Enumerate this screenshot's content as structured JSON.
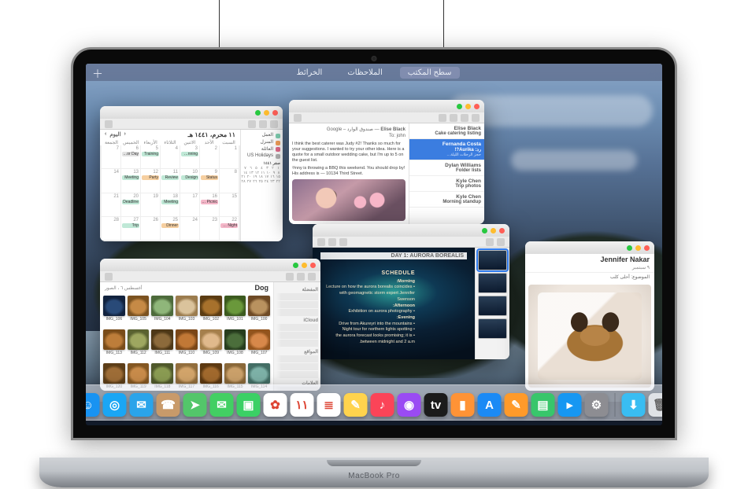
{
  "brand_label": "MacBook Pro",
  "spaces": {
    "items": [
      "سطح المكتب",
      "الملاحظات",
      "الخرائط"
    ],
    "active_index": 0
  },
  "dock": {
    "items": [
      {
        "name": "finder",
        "glyph": "☺",
        "bg": "#1893f2"
      },
      {
        "name": "safari",
        "glyph": "◎",
        "bg": "#1aa6f4"
      },
      {
        "name": "mail",
        "glyph": "✉",
        "bg": "#2aa4ea"
      },
      {
        "name": "contacts",
        "glyph": "☎",
        "bg": "#c89a6a"
      },
      {
        "name": "maps",
        "glyph": "➤",
        "bg": "#53c66a"
      },
      {
        "name": "messages",
        "glyph": "✉",
        "bg": "#42cf63"
      },
      {
        "name": "facetime",
        "glyph": "▣",
        "bg": "#3bd065"
      },
      {
        "name": "photos",
        "glyph": "✿",
        "bg": "#ffffff"
      },
      {
        "name": "calendar",
        "glyph": "١١",
        "bg": "#ffffff"
      },
      {
        "name": "reminders",
        "glyph": "≣",
        "bg": "#ffffff"
      },
      {
        "name": "notes",
        "glyph": "✎",
        "bg": "#ffd34d"
      },
      {
        "name": "music",
        "glyph": "♪",
        "bg": "#fb4458"
      },
      {
        "name": "podcasts",
        "glyph": "◉",
        "bg": "#9a4bf3"
      },
      {
        "name": "tv",
        "glyph": "tv",
        "bg": "#1b1b1b"
      },
      {
        "name": "books",
        "glyph": "▮",
        "bg": "#ff9336"
      },
      {
        "name": "appstore",
        "glyph": "A",
        "bg": "#1b8af5"
      },
      {
        "name": "pages",
        "glyph": "✎",
        "bg": "#ff9a2a"
      },
      {
        "name": "numbers",
        "glyph": "▤",
        "bg": "#38c66b"
      },
      {
        "name": "keynote",
        "glyph": "▸",
        "bg": "#1697f2"
      },
      {
        "name": "preferences",
        "glyph": "⚙",
        "bg": "#8d8d92"
      }
    ],
    "right_items": [
      {
        "name": "downloads",
        "glyph": "⬇",
        "bg": "#39bdf2"
      },
      {
        "name": "trash",
        "glyph": "🗑",
        "bg": "#dfe2e6"
      }
    ]
  },
  "calendar": {
    "title": "١١ محرم، ١٤٤١ هـ",
    "nav_prev": "‹",
    "nav_today": "اليوم",
    "nav_next": "›",
    "day_labels": [
      "السبت",
      "الأحد",
      "الاثنين",
      "الثلاثاء",
      "الأربعاء",
      "الخميس",
      "الجمعة"
    ],
    "categories": [
      {
        "label": "العمل",
        "color": "#7fd0b2"
      },
      {
        "label": "المنزل",
        "color": "#f4a05a"
      },
      {
        "label": "العائلة",
        "color": "#e36b8b"
      },
      {
        "label": "US Holidays",
        "color": "#b4b4b4"
      }
    ],
    "mini_month": "صفر ١٤٤١",
    "events": [
      {
        "row": 0,
        "col": 2,
        "label": "Team Planning",
        "color": "#bfe8d6"
      },
      {
        "row": 0,
        "col": 4,
        "label": "Training",
        "color": "#bfe8d6"
      },
      {
        "row": 0,
        "col": 5,
        "label": "Labor Day",
        "color": "#e2e2e2"
      },
      {
        "row": 1,
        "col": 1,
        "label": "Status",
        "color": "#f6cfa0"
      },
      {
        "row": 1,
        "col": 2,
        "label": "Design",
        "color": "#bfe8d6"
      },
      {
        "row": 1,
        "col": 3,
        "label": "Review",
        "color": "#bfe8d6"
      },
      {
        "row": 1,
        "col": 4,
        "label": "Party",
        "color": "#f6cfa0"
      },
      {
        "row": 1,
        "col": 5,
        "label": "Meeting",
        "color": "#bfe8d6"
      },
      {
        "row": 2,
        "col": 1,
        "label": "Family Picnic",
        "color": "#f4b6c8"
      },
      {
        "row": 2,
        "col": 3,
        "label": "Meeting",
        "color": "#bfe8d6"
      },
      {
        "row": 2,
        "col": 5,
        "label": "Deadline",
        "color": "#bfe8d6"
      },
      {
        "row": 3,
        "col": 0,
        "label": "Movie Night",
        "color": "#f4b6c8"
      },
      {
        "row": 3,
        "col": 3,
        "label": "Dinner",
        "color": "#f6cfa0"
      },
      {
        "row": 3,
        "col": 5,
        "label": "Trip",
        "color": "#bfe8d6"
      }
    ]
  },
  "mail": {
    "messages": [
      {
        "from": "Elise Black",
        "subject": "Cake catering listing",
        "preview": "",
        "selected": false
      },
      {
        "from": "Fernanda Costa",
        "subject": "رد: Aurika?!",
        "preview": "حجز الرحلات الليلة…",
        "selected": true
      },
      {
        "from": "Dylan Williams",
        "subject": "Folder lists",
        "preview": "",
        "selected": false
      },
      {
        "from": "Kyle Chen",
        "subject": "Trip photos",
        "preview": "",
        "selected": false
      },
      {
        "from": "Kyle Chen",
        "subject": "Morning standup",
        "preview": "",
        "selected": false
      }
    ],
    "open": {
      "from": "Elise Black",
      "tag": "صندوق الوارد – Google",
      "to": "To: john",
      "body": "I think the best caterer was Judy #2! Thanks so much for your suggestions. I wanted to try your other idea. Here is a quote for a small outdoor wedding cake, but I'm up to 5 on the guest list.",
      "body_2": "কnny is throwing a BBQ this weekend. You should drop by! His address is — 10134 Third Street."
    }
  },
  "keynote": {
    "title_strip": "DAY 1: AURORA BOREALIS",
    "schedule_title": "SCHEDULE",
    "morning_head": "Morning:",
    "morning_items": [
      "• Lecture on how the aurora borealis coincides with geomagnetic storm expert Jennifer Swenson"
    ],
    "afternoon_head": "Afternoon:",
    "afternoon_items": [
      "• Exhibition on aurora photography"
    ],
    "evening_head": "Evening:",
    "evening_items": [
      "• Drive from Akureyri into the mountains",
      "• Night tour for northern lights spotting",
      "• the aurora forecast looks promising; it is between midnight and 2 a.m."
    ]
  },
  "finder": {
    "title": "Dog",
    "path_hint": "أغسطس ٦ ، الصور",
    "sidebar_sections": [
      "المفضلة",
      "iCloud",
      "المواقع",
      "العلامات"
    ],
    "thumbs": [
      {
        "c1": "#b9925f",
        "c2": "#6e4a25"
      },
      {
        "c1": "#6a983b",
        "c2": "#3c5a1f"
      },
      {
        "c1": "#a7712c",
        "c2": "#5b3c12"
      },
      {
        "c1": "#dac39c",
        "c2": "#9b7c4e"
      },
      {
        "c1": "#8fb67a",
        "c2": "#4d6b3b"
      },
      {
        "c1": "#c68a46",
        "c2": "#7b5220"
      },
      {
        "c1": "#294a78",
        "c2": "#11223e"
      },
      {
        "c1": "#d7884a",
        "c2": "#93541d"
      },
      {
        "c1": "#4b6e3b",
        "c2": "#273d1e"
      },
      {
        "c1": "#e0b98c",
        "c2": "#a57f4c"
      },
      {
        "c1": "#c17836",
        "c2": "#7a4617"
      },
      {
        "c1": "#8c6a3b",
        "c2": "#4e3817"
      },
      {
        "c1": "#9ea760",
        "c2": "#5a6231"
      },
      {
        "c1": "#bd7d3a",
        "c2": "#794c1a"
      },
      {
        "c1": "#7db1a7",
        "c2": "#436e65"
      },
      {
        "c1": "#caa06a",
        "c2": "#8a6839"
      },
      {
        "c1": "#a1692d",
        "c2": "#5d3911"
      },
      {
        "c1": "#d2a46a",
        "c2": "#926e3d"
      },
      {
        "c1": "#8a9b52",
        "c2": "#50592b"
      },
      {
        "c1": "#c88b4a",
        "c2": "#845722"
      },
      {
        "c1": "#9e6d37",
        "c2": "#5d3e18"
      }
    ]
  },
  "note": {
    "author": "Jennifer Nakar",
    "meta": "٩ سبتمبر",
    "subject_label": "الموضوع:",
    "subject_value": "أحلى كلب"
  }
}
